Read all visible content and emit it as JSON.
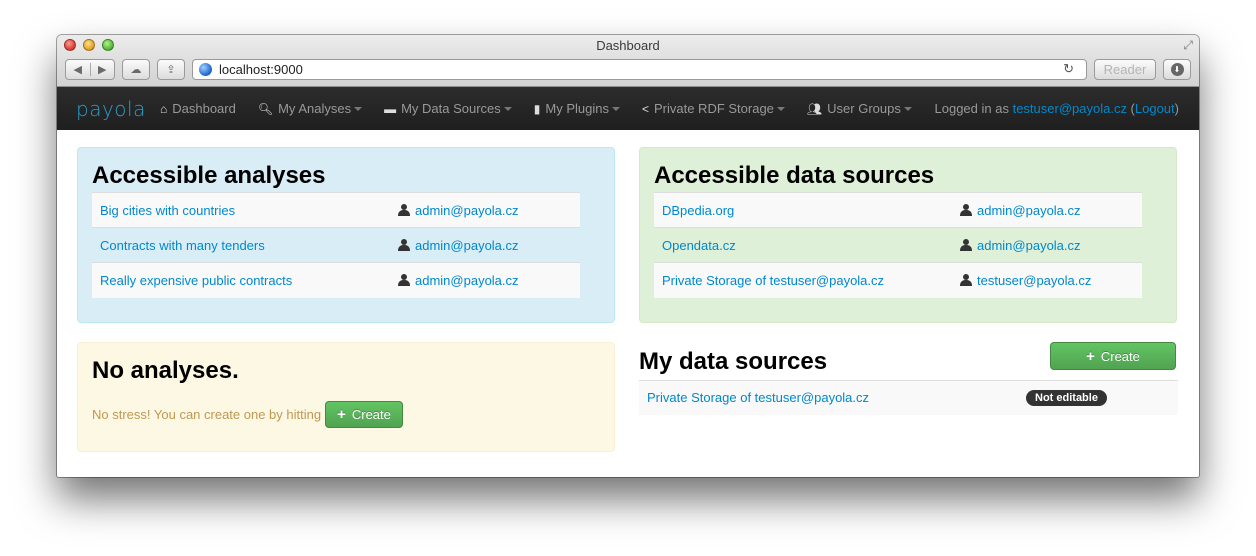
{
  "browser": {
    "window_title": "Dashboard",
    "url": "localhost:9000",
    "reader_label": "Reader"
  },
  "navbar": {
    "brand": "payola",
    "items": [
      {
        "label": "Dashboard",
        "icon": "home-icon",
        "dropdown": false
      },
      {
        "label": "My Analyses",
        "icon": "search-icon",
        "dropdown": true
      },
      {
        "label": "My Data Sources",
        "icon": "hdd-icon",
        "dropdown": true
      },
      {
        "label": "My Plugins",
        "icon": "file-icon",
        "dropdown": true
      },
      {
        "label": "Private RDF Storage",
        "icon": "share-icon",
        "dropdown": true
      },
      {
        "label": "User Groups",
        "icon": "users-icon",
        "dropdown": true
      }
    ],
    "login_prefix": "Logged in as",
    "user": "testuser@payola.cz",
    "logout_label": "Logout"
  },
  "accessible_analyses": {
    "title": "Accessible analyses",
    "rows": [
      {
        "name": "Big cities with countries",
        "owner": "admin@payola.cz"
      },
      {
        "name": "Contracts with many tenders",
        "owner": "admin@payola.cz"
      },
      {
        "name": "Really expensive public contracts",
        "owner": "admin@payola.cz"
      }
    ]
  },
  "accessible_data_sources": {
    "title": "Accessible data sources",
    "rows": [
      {
        "name": "DBpedia.org",
        "owner": "admin@payola.cz"
      },
      {
        "name": "Opendata.cz",
        "owner": "admin@payola.cz"
      },
      {
        "name": "Private Storage of testuser@payola.cz",
        "owner": "testuser@payola.cz"
      }
    ]
  },
  "no_analyses": {
    "title": "No analyses.",
    "text": "No stress! You can create one by hitting",
    "create_label": "Create"
  },
  "my_data_sources": {
    "title": "My data sources",
    "create_label": "Create",
    "rows": [
      {
        "name": "Private Storage of testuser@payola.cz",
        "badge": "Not editable"
      }
    ]
  },
  "colors": {
    "link": "#0088cc",
    "info_well": "#d9edf7",
    "success_well": "#dff0d8",
    "warning_well": "#fcf8e3",
    "button_success": "#5bb75b",
    "navbar": "#222222"
  }
}
